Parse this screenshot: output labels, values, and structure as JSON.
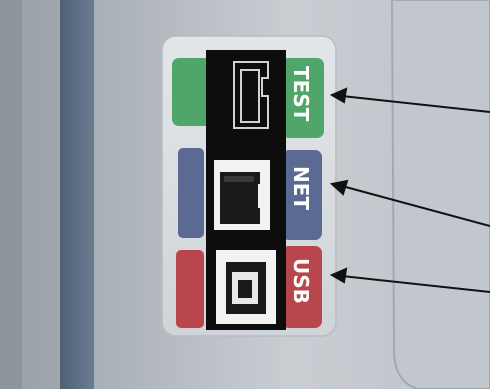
{
  "photo": {
    "labels": {
      "test": "TEST",
      "net": "NET",
      "usb": "USB"
    },
    "colors": {
      "wall": "#b7bcc2",
      "device_frame": "#5f7185",
      "panel": "#c6cbd1",
      "label_plate": "#d8dde1",
      "test_green": "#4fa668",
      "net_blue": "#5a6a93",
      "usb_red": "#b8464c",
      "connector_black": "#0d0d0d",
      "arrow": "#111111"
    }
  }
}
